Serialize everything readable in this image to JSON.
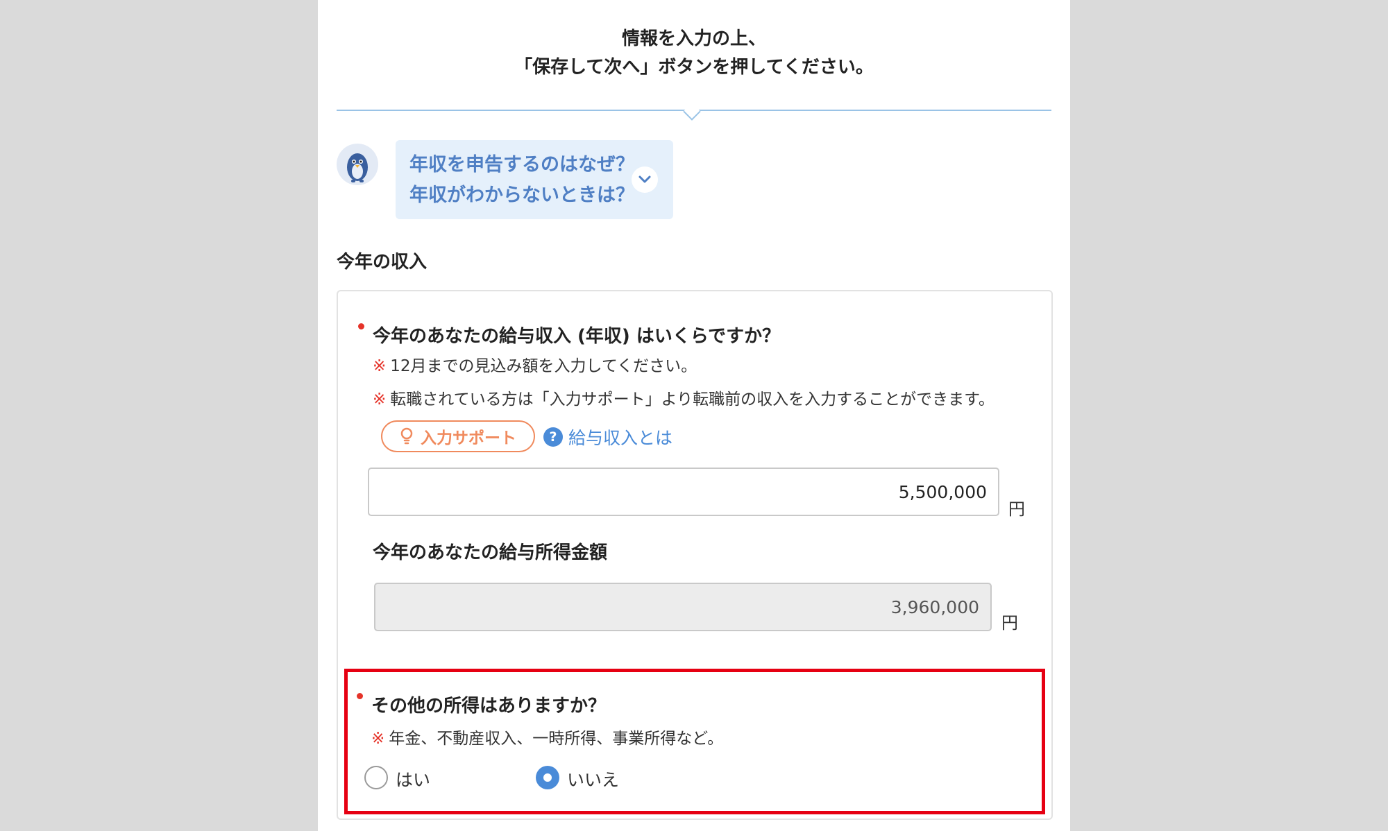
{
  "header": {
    "instruction_line1": "情報を入力の上、",
    "instruction_line2": "「保存して次へ」ボタンを押してください。"
  },
  "faq": {
    "line1": "年収を申告するのはなぜ？",
    "line2": "年収がわからないときは？",
    "expand_icon": "chevron-down-icon"
  },
  "section": {
    "title": "今年の収入"
  },
  "salary_question": {
    "label": "今年のあなたの給与収入 (年収) はいくらですか？",
    "note1_mark": "※",
    "note1": "12月までの見込み額を入力してください。",
    "note2_mark": "※",
    "note2": "転職されている方は「入力サポート」より転職前の収入を入力することができます。",
    "support_button": "入力サポート",
    "help_link": "給与収入とは",
    "help_icon_text": "?",
    "value": "5,500,000",
    "unit": "円"
  },
  "income_amount": {
    "label": "今年のあなたの給与所得金額",
    "value": "3,960,000",
    "unit": "円"
  },
  "other_income": {
    "label": "その他の所得はありますか？",
    "note_mark": "※",
    "note": "年金、不動産収入、一時所得、事業所得など。",
    "options": [
      {
        "label": "はい",
        "selected": false
      },
      {
        "label": "いいえ",
        "selected": true
      }
    ]
  },
  "colors": {
    "accent_blue": "#4a8bd8",
    "required_red": "#e53329",
    "highlight_red": "#e60012",
    "support_orange": "#f08a5d"
  }
}
